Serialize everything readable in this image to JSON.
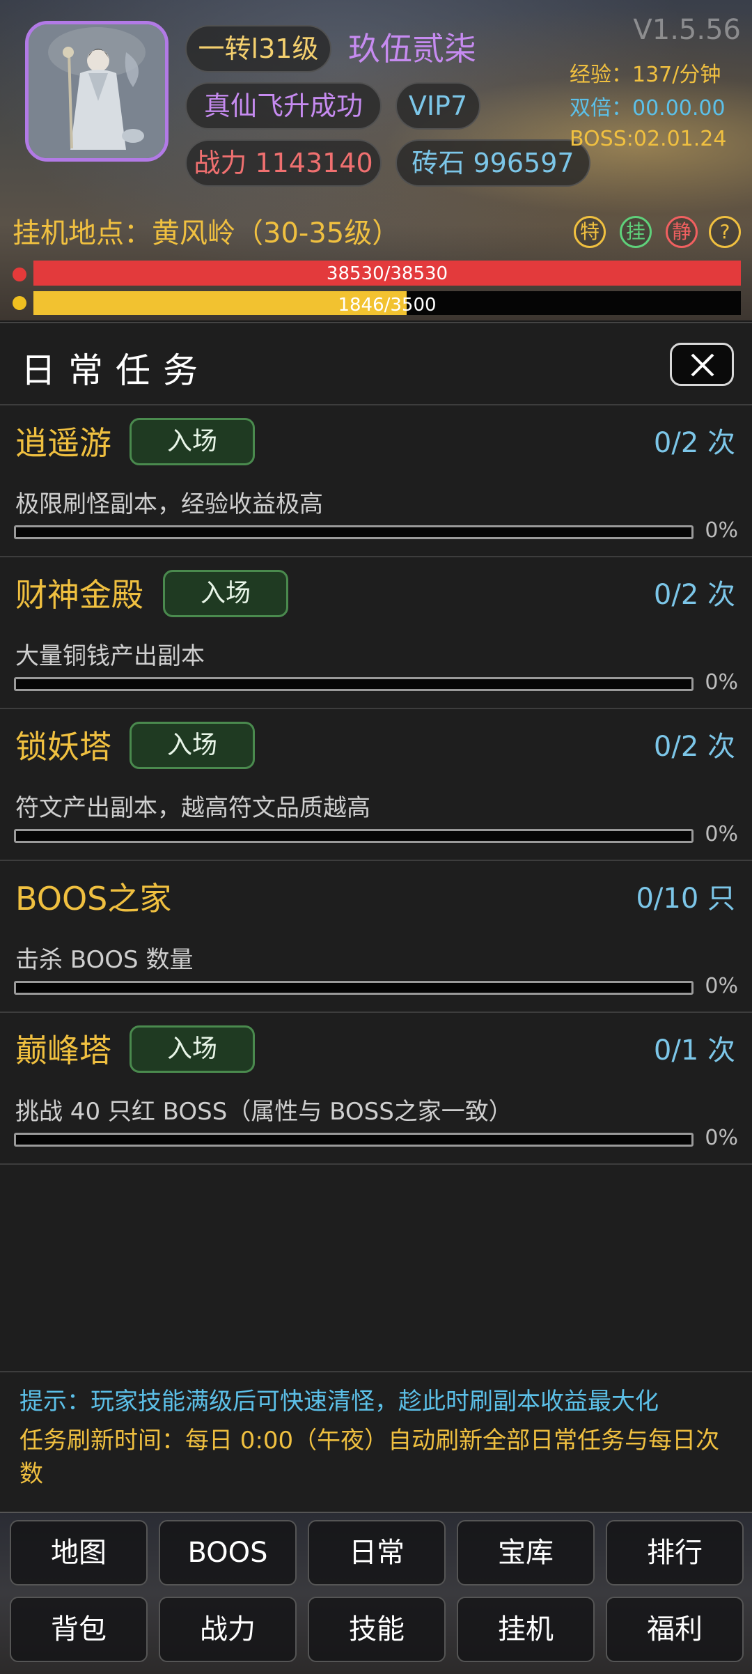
{
  "header": {
    "version": "V1.5.56",
    "level": "一转l31级",
    "player_name": "玖伍贰柒",
    "realm_status": "真仙飞升成功",
    "vip": "VIP7",
    "power": "战力 1143140",
    "bricks": "砖石 996597",
    "exp_rate": "经验：137/分钟",
    "double_time": "双倍：00.00.00",
    "boss_timer": "BOSS:02.01.24",
    "location": "挂机地点：黄风岭（30-35级）",
    "badges": {
      "te": "特",
      "gua": "挂",
      "jing": "静",
      "help": "?"
    },
    "hp": {
      "text": "38530/38530",
      "current": 38530,
      "max": 38530
    },
    "mp": {
      "text": "1846/3500",
      "current": 1846,
      "max": 3500
    }
  },
  "panel": {
    "title": "日常任务",
    "tasks": [
      {
        "name": "逍遥游",
        "button": "入场",
        "count": "0/2 次",
        "desc": "极限刷怪副本，经验收益极高",
        "progress": "0%",
        "progress_value": 0
      },
      {
        "name": "财神金殿",
        "button": "入场",
        "count": "0/2 次",
        "desc": "大量铜钱产出副本",
        "progress": "0%",
        "progress_value": 0
      },
      {
        "name": "锁妖塔",
        "button": "入场",
        "count": "0/2 次",
        "desc": "符文产出副本，越高符文品质越高",
        "progress": "0%",
        "progress_value": 0
      },
      {
        "name": "BOOS之家",
        "button": "",
        "count": "0/10 只",
        "desc": "击杀 BOOS 数量",
        "progress": "0%",
        "progress_value": 0
      },
      {
        "name": "巅峰塔",
        "button": "入场",
        "count": "0/1 次",
        "desc": "挑战 40 只红 BOSS（属性与 BOSS之家一致）",
        "progress": "0%",
        "progress_value": 0
      }
    ],
    "tip": "提示：玩家技能满级后可快速清怪，趁此时刷副本收益最大化",
    "refresh": "任务刷新时间：每日 0:00（午夜）自动刷新全部日常任务与每日次数"
  },
  "nav": {
    "row1": [
      "地图",
      "BOOS",
      "日常",
      "宝库",
      "排行"
    ],
    "row2": [
      "背包",
      "战力",
      "技能",
      "挂机",
      "福利"
    ]
  },
  "colors": {
    "gold": "#f0c040",
    "blue": "#7cc6e8",
    "purple": "#c68bf0",
    "hp_red": "#e33a3c",
    "mp_yellow": "#f2c230",
    "enter_green": "#1f3a22"
  }
}
